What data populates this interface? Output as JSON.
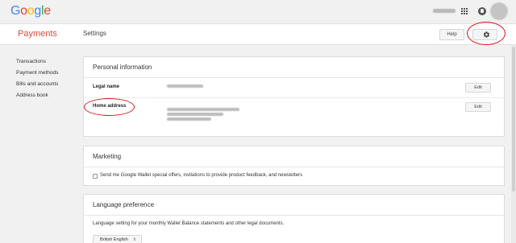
{
  "header": {
    "logo_letters": [
      "G",
      "o",
      "o",
      "g",
      "l",
      "e"
    ],
    "icons": [
      "apps-grid-icon",
      "notifications-icon",
      "avatar"
    ]
  },
  "subheader": {
    "product_name": "Payments",
    "section_title": "Settings",
    "help_label": "Help",
    "settings_icon": "gear-icon"
  },
  "sidebar": {
    "items": [
      {
        "label": "Transactions"
      },
      {
        "label": "Payment methods"
      },
      {
        "label": "Bills and accounts"
      },
      {
        "label": "Address book"
      }
    ]
  },
  "personal_info": {
    "title": "Personal information",
    "legal_name_label": "Legal name",
    "home_address_label": "Home address",
    "edit_label": "Edit"
  },
  "marketing": {
    "title": "Marketing",
    "checkbox_label": "Send me Google Wallet special offers, invitations to provide product feedback, and newsletters",
    "checked": false
  },
  "language": {
    "title": "Language preference",
    "description": "Language setting for your monthly Wallet Balance statements and other legal documents.",
    "selected": "British English"
  },
  "colors": {
    "brand_red": "#dd4b39",
    "annotation_red": "#d81919"
  }
}
